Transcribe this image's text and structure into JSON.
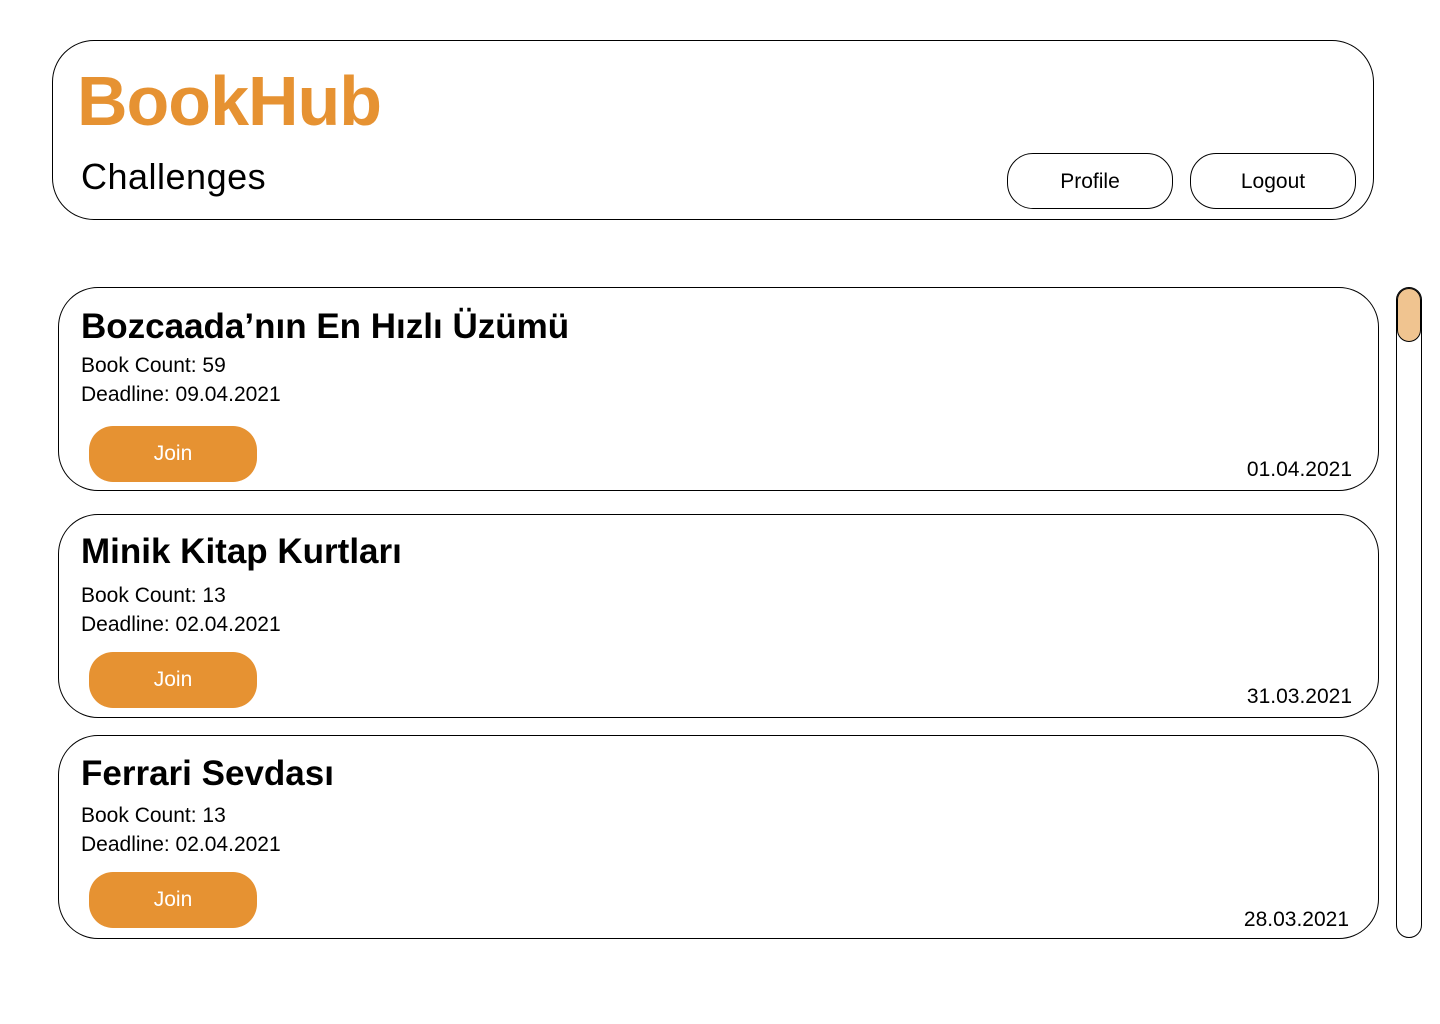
{
  "app": {
    "brand": "BookHub",
    "page_title": "Challenges",
    "accent_color": "#e69232"
  },
  "header": {
    "profile_label": "Profile",
    "logout_label": "Logout"
  },
  "challenges": [
    {
      "title": "Bozcaada’nın En Hızlı Üzümü",
      "book_count": "Book Count: 59",
      "deadline": "Deadline: 09.04.2021",
      "join_label": "Join",
      "date": "01.04.2021"
    },
    {
      "title": "Minik Kitap Kurtları",
      "book_count": "Book Count: 13",
      "deadline": "Deadline: 02.04.2021",
      "join_label": "Join",
      "date": "31.03.2021"
    },
    {
      "title": "Ferrari Sevdası",
      "book_count": "Book Count: 13",
      "deadline": "Deadline: 02.04.2021",
      "join_label": "Join",
      "date": "28.03.2021"
    }
  ],
  "scrollbar": {
    "thumb_color": "#f0c490",
    "scroll_position": 0
  }
}
